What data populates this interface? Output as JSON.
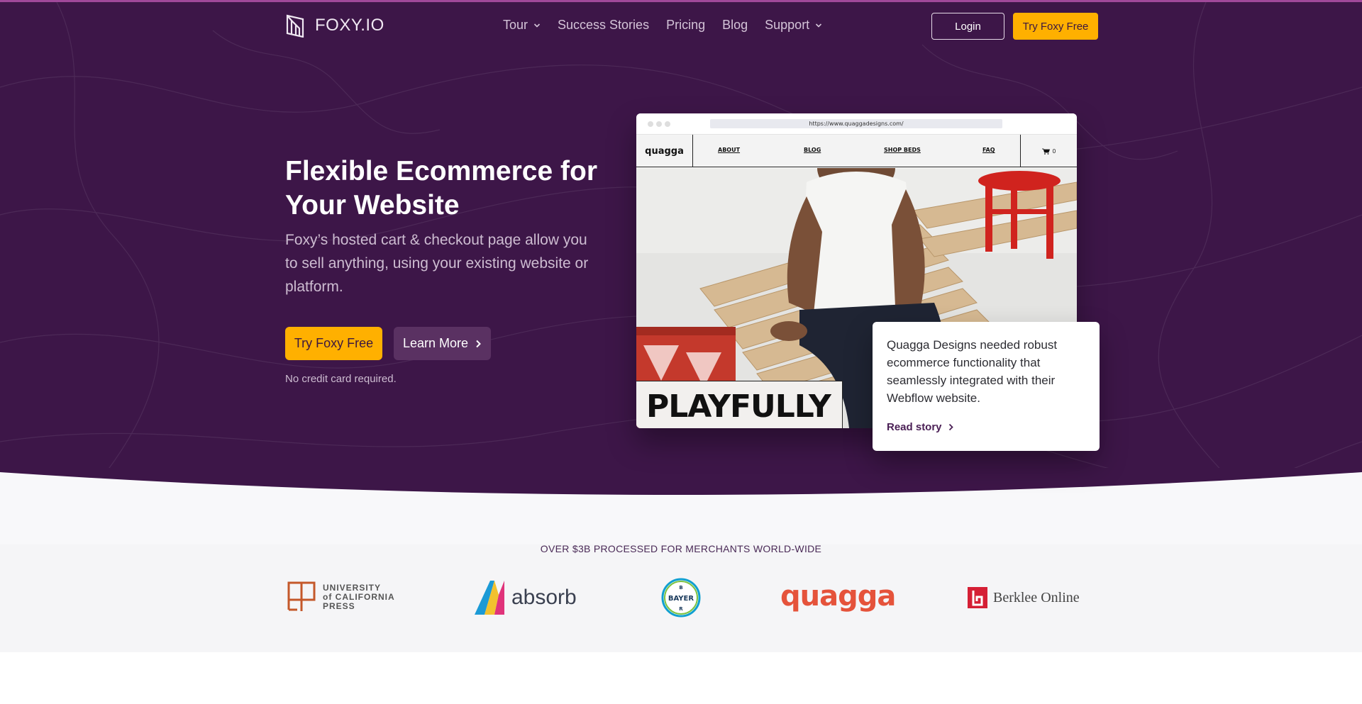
{
  "brand": {
    "name": "FOXY.IO"
  },
  "nav": {
    "items": [
      {
        "label": "Tour",
        "has_dropdown": true
      },
      {
        "label": "Success Stories",
        "has_dropdown": false
      },
      {
        "label": "Pricing",
        "has_dropdown": false
      },
      {
        "label": "Blog",
        "has_dropdown": false
      },
      {
        "label": "Support",
        "has_dropdown": true
      }
    ],
    "login_label": "Login",
    "try_label": "Try Foxy Free"
  },
  "hero": {
    "headline": "Flexible Ecommerce for Your Website",
    "subhead": "Foxy’s hosted cart & checkout page allow you to sell anything, using your existing website or platform.",
    "primary_cta": "Try Foxy Free",
    "secondary_cta": "Learn More",
    "note": "No credit card required."
  },
  "mockup": {
    "url": "https://www.quaggadesigns.com/",
    "site_logo": "quagga",
    "links": [
      "ABOUT",
      "BLOG",
      "SHOP BEDS",
      "FAQ"
    ],
    "cart_count": "0",
    "banner_text": "PLAYFULLY MADE"
  },
  "story_card": {
    "text": "Quagga Designs needed robust ecommerce functionality that seamlessly integrated with their Webflow website.",
    "link_label": "Read story"
  },
  "logos": {
    "tagline": "OVER $3B PROCESSED FOR MERCHANTS WORLD-WIDE",
    "ucp": {
      "line1": "UNIVERSITY",
      "line2": "of CALIFORNIA",
      "line3": "PRESS"
    },
    "absorb": "absorb",
    "bayer": "BAYER",
    "quagga": "quagga",
    "berklee": "Berklee Online"
  },
  "colors": {
    "hero_bg": "#3d1648",
    "accent": "#ffb000",
    "secondary_button": "#5a3162",
    "logos_band": "#f5f5f7"
  }
}
